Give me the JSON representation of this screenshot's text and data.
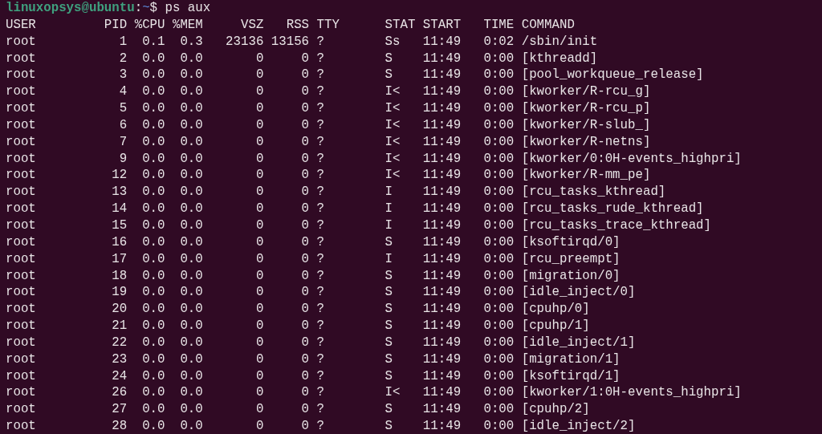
{
  "prompt": {
    "user_host": "linuxopsys@ubuntu",
    "separator": ":",
    "path": "~",
    "symbol": "$",
    "command": "ps aux"
  },
  "columns": [
    "USER",
    "PID",
    "%CPU",
    "%MEM",
    "VSZ",
    "RSS",
    "TTY",
    "STAT",
    "START",
    "TIME",
    "COMMAND"
  ],
  "rows": [
    {
      "user": "root",
      "pid": "1",
      "cpu": "0.1",
      "mem": "0.3",
      "vsz": "23136",
      "rss": "13156",
      "tty": "?",
      "stat": "Ss",
      "start": "11:49",
      "time": "0:02",
      "command": "/sbin/init"
    },
    {
      "user": "root",
      "pid": "2",
      "cpu": "0.0",
      "mem": "0.0",
      "vsz": "0",
      "rss": "0",
      "tty": "?",
      "stat": "S",
      "start": "11:49",
      "time": "0:00",
      "command": "[kthreadd]"
    },
    {
      "user": "root",
      "pid": "3",
      "cpu": "0.0",
      "mem": "0.0",
      "vsz": "0",
      "rss": "0",
      "tty": "?",
      "stat": "S",
      "start": "11:49",
      "time": "0:00",
      "command": "[pool_workqueue_release]"
    },
    {
      "user": "root",
      "pid": "4",
      "cpu": "0.0",
      "mem": "0.0",
      "vsz": "0",
      "rss": "0",
      "tty": "?",
      "stat": "I<",
      "start": "11:49",
      "time": "0:00",
      "command": "[kworker/R-rcu_g]"
    },
    {
      "user": "root",
      "pid": "5",
      "cpu": "0.0",
      "mem": "0.0",
      "vsz": "0",
      "rss": "0",
      "tty": "?",
      "stat": "I<",
      "start": "11:49",
      "time": "0:00",
      "command": "[kworker/R-rcu_p]"
    },
    {
      "user": "root",
      "pid": "6",
      "cpu": "0.0",
      "mem": "0.0",
      "vsz": "0",
      "rss": "0",
      "tty": "?",
      "stat": "I<",
      "start": "11:49",
      "time": "0:00",
      "command": "[kworker/R-slub_]"
    },
    {
      "user": "root",
      "pid": "7",
      "cpu": "0.0",
      "mem": "0.0",
      "vsz": "0",
      "rss": "0",
      "tty": "?",
      "stat": "I<",
      "start": "11:49",
      "time": "0:00",
      "command": "[kworker/R-netns]"
    },
    {
      "user": "root",
      "pid": "9",
      "cpu": "0.0",
      "mem": "0.0",
      "vsz": "0",
      "rss": "0",
      "tty": "?",
      "stat": "I<",
      "start": "11:49",
      "time": "0:00",
      "command": "[kworker/0:0H-events_highpri]"
    },
    {
      "user": "root",
      "pid": "12",
      "cpu": "0.0",
      "mem": "0.0",
      "vsz": "0",
      "rss": "0",
      "tty": "?",
      "stat": "I<",
      "start": "11:49",
      "time": "0:00",
      "command": "[kworker/R-mm_pe]"
    },
    {
      "user": "root",
      "pid": "13",
      "cpu": "0.0",
      "mem": "0.0",
      "vsz": "0",
      "rss": "0",
      "tty": "?",
      "stat": "I",
      "start": "11:49",
      "time": "0:00",
      "command": "[rcu_tasks_kthread]"
    },
    {
      "user": "root",
      "pid": "14",
      "cpu": "0.0",
      "mem": "0.0",
      "vsz": "0",
      "rss": "0",
      "tty": "?",
      "stat": "I",
      "start": "11:49",
      "time": "0:00",
      "command": "[rcu_tasks_rude_kthread]"
    },
    {
      "user": "root",
      "pid": "15",
      "cpu": "0.0",
      "mem": "0.0",
      "vsz": "0",
      "rss": "0",
      "tty": "?",
      "stat": "I",
      "start": "11:49",
      "time": "0:00",
      "command": "[rcu_tasks_trace_kthread]"
    },
    {
      "user": "root",
      "pid": "16",
      "cpu": "0.0",
      "mem": "0.0",
      "vsz": "0",
      "rss": "0",
      "tty": "?",
      "stat": "S",
      "start": "11:49",
      "time": "0:00",
      "command": "[ksoftirqd/0]"
    },
    {
      "user": "root",
      "pid": "17",
      "cpu": "0.0",
      "mem": "0.0",
      "vsz": "0",
      "rss": "0",
      "tty": "?",
      "stat": "I",
      "start": "11:49",
      "time": "0:00",
      "command": "[rcu_preempt]"
    },
    {
      "user": "root",
      "pid": "18",
      "cpu": "0.0",
      "mem": "0.0",
      "vsz": "0",
      "rss": "0",
      "tty": "?",
      "stat": "S",
      "start": "11:49",
      "time": "0:00",
      "command": "[migration/0]"
    },
    {
      "user": "root",
      "pid": "19",
      "cpu": "0.0",
      "mem": "0.0",
      "vsz": "0",
      "rss": "0",
      "tty": "?",
      "stat": "S",
      "start": "11:49",
      "time": "0:00",
      "command": "[idle_inject/0]"
    },
    {
      "user": "root",
      "pid": "20",
      "cpu": "0.0",
      "mem": "0.0",
      "vsz": "0",
      "rss": "0",
      "tty": "?",
      "stat": "S",
      "start": "11:49",
      "time": "0:00",
      "command": "[cpuhp/0]"
    },
    {
      "user": "root",
      "pid": "21",
      "cpu": "0.0",
      "mem": "0.0",
      "vsz": "0",
      "rss": "0",
      "tty": "?",
      "stat": "S",
      "start": "11:49",
      "time": "0:00",
      "command": "[cpuhp/1]"
    },
    {
      "user": "root",
      "pid": "22",
      "cpu": "0.0",
      "mem": "0.0",
      "vsz": "0",
      "rss": "0",
      "tty": "?",
      "stat": "S",
      "start": "11:49",
      "time": "0:00",
      "command": "[idle_inject/1]"
    },
    {
      "user": "root",
      "pid": "23",
      "cpu": "0.0",
      "mem": "0.0",
      "vsz": "0",
      "rss": "0",
      "tty": "?",
      "stat": "S",
      "start": "11:49",
      "time": "0:00",
      "command": "[migration/1]"
    },
    {
      "user": "root",
      "pid": "24",
      "cpu": "0.0",
      "mem": "0.0",
      "vsz": "0",
      "rss": "0",
      "tty": "?",
      "stat": "S",
      "start": "11:49",
      "time": "0:00",
      "command": "[ksoftirqd/1]"
    },
    {
      "user": "root",
      "pid": "26",
      "cpu": "0.0",
      "mem": "0.0",
      "vsz": "0",
      "rss": "0",
      "tty": "?",
      "stat": "I<",
      "start": "11:49",
      "time": "0:00",
      "command": "[kworker/1:0H-events_highpri]"
    },
    {
      "user": "root",
      "pid": "27",
      "cpu": "0.0",
      "mem": "0.0",
      "vsz": "0",
      "rss": "0",
      "tty": "?",
      "stat": "S",
      "start": "11:49",
      "time": "0:00",
      "command": "[cpuhp/2]"
    },
    {
      "user": "root",
      "pid": "28",
      "cpu": "0.0",
      "mem": "0.0",
      "vsz": "0",
      "rss": "0",
      "tty": "?",
      "stat": "S",
      "start": "11:49",
      "time": "0:00",
      "command": "[idle_inject/2]"
    }
  ]
}
